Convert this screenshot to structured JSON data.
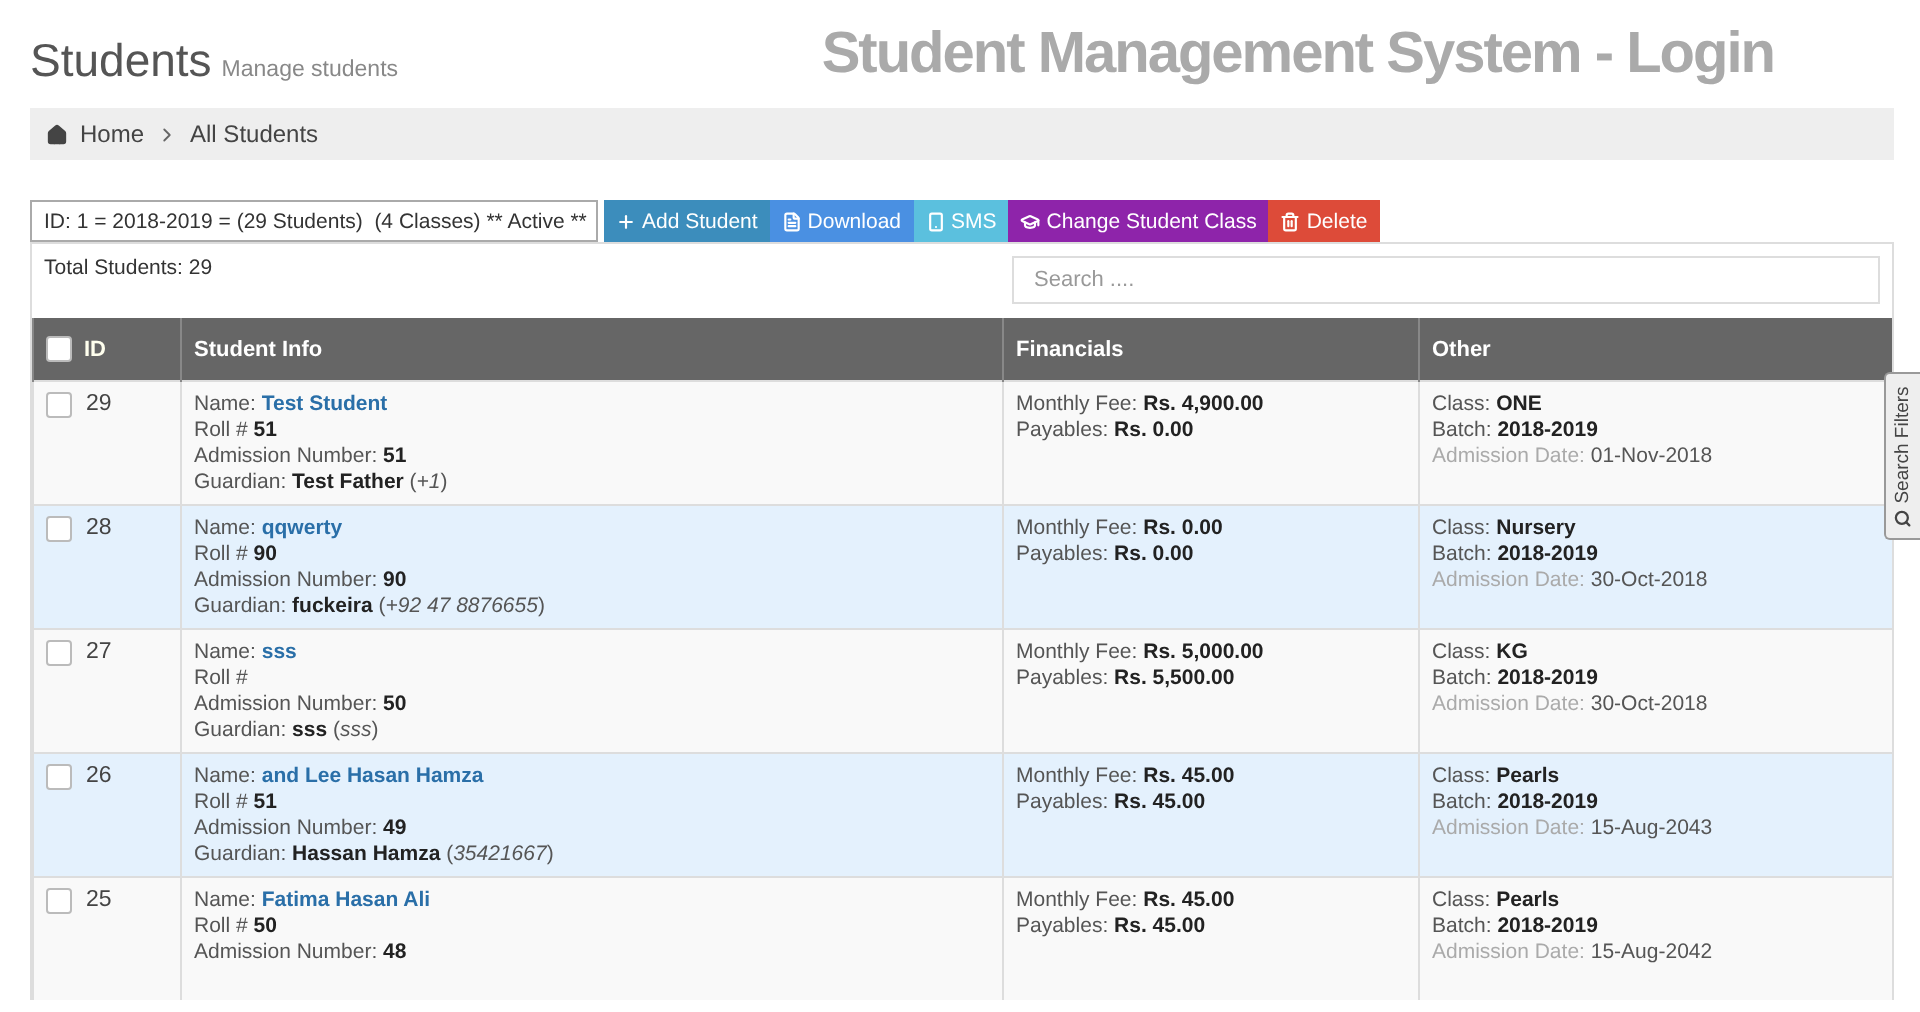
{
  "header": {
    "title": "Students",
    "subtitle": "Manage students",
    "banner": "Student Management System - Login"
  },
  "breadcrumb": [
    {
      "label": "Home",
      "kind": "home"
    },
    {
      "label": "All Students",
      "kind": "current"
    }
  ],
  "toolbar": {
    "session_select": "ID: 1 = 2018-2019 = (29 Students)  (4 Classes) ** Active **",
    "buttons": [
      {
        "label": "Add Student",
        "kind": "add",
        "color": "#3c8dbc"
      },
      {
        "label": "Download",
        "kind": "download",
        "color": "#4a90e2"
      },
      {
        "label": "SMS",
        "kind": "sms",
        "color": "#5bc0de"
      },
      {
        "label": "Change Student Class",
        "kind": "class",
        "color": "#8e24aa"
      },
      {
        "label": "Delete",
        "kind": "delete",
        "color": "#dd4b39"
      }
    ]
  },
  "summary": "Total Students: 29",
  "search": {
    "placeholder": "Search ...."
  },
  "side_tab": "Search Filters",
  "table": {
    "columns": [
      "ID",
      "Student Info",
      "Financials",
      "Other"
    ],
    "select_all_checked": false,
    "rows": [
      {
        "id": "29",
        "checked": false,
        "info": [
          {
            "label": "Name:",
            "value": "Test Student",
            "kind": "link"
          },
          {
            "label": "Roll #",
            "value": "51",
            "kind": "bold"
          },
          {
            "label": "Admission Number:",
            "value": "51",
            "kind": "bold"
          },
          {
            "label": "Guardian:",
            "value": "Test Father",
            "note": "(*+1*)",
            "kind": "bold"
          }
        ],
        "financials": [
          {
            "label": "Monthly Fee:",
            "value": "Rs. 4,900.00",
            "kind": "bold"
          },
          {
            "label": "Payables:",
            "value": "Rs. 0.00",
            "kind": "bold"
          }
        ],
        "other": [
          {
            "label": "Class:",
            "value": "ONE",
            "kind": "bold"
          },
          {
            "label": "Batch:",
            "value": "2018-2019",
            "kind": "bold"
          },
          {
            "label": "Admission Date:",
            "value": "01-Nov-2018",
            "kind": "date"
          }
        ]
      },
      {
        "id": "28",
        "checked": false,
        "info": [
          {
            "label": "Name:",
            "value": "qqwerty",
            "kind": "link"
          },
          {
            "label": "Roll #",
            "value": "90",
            "kind": "bold"
          },
          {
            "label": "Admission Number:",
            "value": "90",
            "kind": "bold"
          },
          {
            "label": "Guardian:",
            "value": "fuckeira",
            "note": "(*+92 47 8876655*)",
            "kind": "bold"
          }
        ],
        "financials": [
          {
            "label": "Monthly Fee:",
            "value": "Rs. 0.00",
            "kind": "bold"
          },
          {
            "label": "Payables:",
            "value": "Rs. 0.00",
            "kind": "bold"
          }
        ],
        "other": [
          {
            "label": "Class:",
            "value": "Nursery",
            "kind": "bold"
          },
          {
            "label": "Batch:",
            "value": "2018-2019",
            "kind": "bold"
          },
          {
            "label": "Admission Date:",
            "value": "30-Oct-2018",
            "kind": "date"
          }
        ]
      },
      {
        "id": "27",
        "checked": false,
        "info": [
          {
            "label": "Name:",
            "value": "sss",
            "kind": "link"
          },
          {
            "label": "Roll #",
            "kind": "bold"
          },
          {
            "label": "Admission Number:",
            "value": "50",
            "kind": "bold"
          },
          {
            "label": "Guardian:",
            "value": "sss",
            "note": "(*sss*)",
            "kind": "bold"
          }
        ],
        "financials": [
          {
            "label": "Monthly Fee:",
            "value": "Rs. 5,000.00",
            "kind": "bold"
          },
          {
            "label": "Payables:",
            "value": "Rs. 5,500.00",
            "kind": "bold"
          }
        ],
        "other": [
          {
            "label": "Class:",
            "value": "KG",
            "kind": "bold"
          },
          {
            "label": "Batch:",
            "value": "2018-2019",
            "kind": "bold"
          },
          {
            "label": "Admission Date:",
            "value": "30-Oct-2018",
            "kind": "date"
          }
        ]
      },
      {
        "id": "26",
        "checked": false,
        "info": [
          {
            "label": "Name:",
            "value": "and Lee Hasan Hamza",
            "kind": "link"
          },
          {
            "label": "Roll #",
            "value": "51",
            "kind": "bold"
          },
          {
            "label": "Admission Number:",
            "value": "49",
            "kind": "bold"
          },
          {
            "label": "Guardian:",
            "value": "Hassan Hamza",
            "note": "(*35421667*)",
            "kind": "bold"
          }
        ],
        "financials": [
          {
            "label": "Monthly Fee:",
            "value": "Rs. 45.00",
            "kind": "bold"
          },
          {
            "label": "Payables:",
            "value": "Rs. 45.00",
            "kind": "bold"
          }
        ],
        "other": [
          {
            "label": "Class:",
            "value": "Pearls",
            "kind": "bold"
          },
          {
            "label": "Batch:",
            "value": "2018-2019",
            "kind": "bold"
          },
          {
            "label": "Admission Date:",
            "value": "15-Aug-2043",
            "kind": "date"
          }
        ]
      },
      {
        "id": "25",
        "checked": false,
        "info": [
          {
            "label": "Name:",
            "value": "Fatima Hasan Ali",
            "kind": "link"
          },
          {
            "label": "Roll #",
            "value": "50",
            "kind": "bold"
          },
          {
            "label": "Admission Number:",
            "value": "48",
            "kind": "bold"
          }
        ],
        "financials": [
          {
            "label": "Monthly Fee:",
            "value": "Rs. 45.00",
            "kind": "bold"
          },
          {
            "label": "Payables:",
            "value": "Rs. 45.00",
            "kind": "bold"
          }
        ],
        "other": [
          {
            "label": "Class:",
            "value": "Pearls",
            "kind": "bold"
          },
          {
            "label": "Batch:",
            "value": "2018-2019",
            "kind": "bold"
          },
          {
            "label": "Admission Date:",
            "value": "15-Aug-2042",
            "kind": "date"
          }
        ]
      }
    ]
  }
}
